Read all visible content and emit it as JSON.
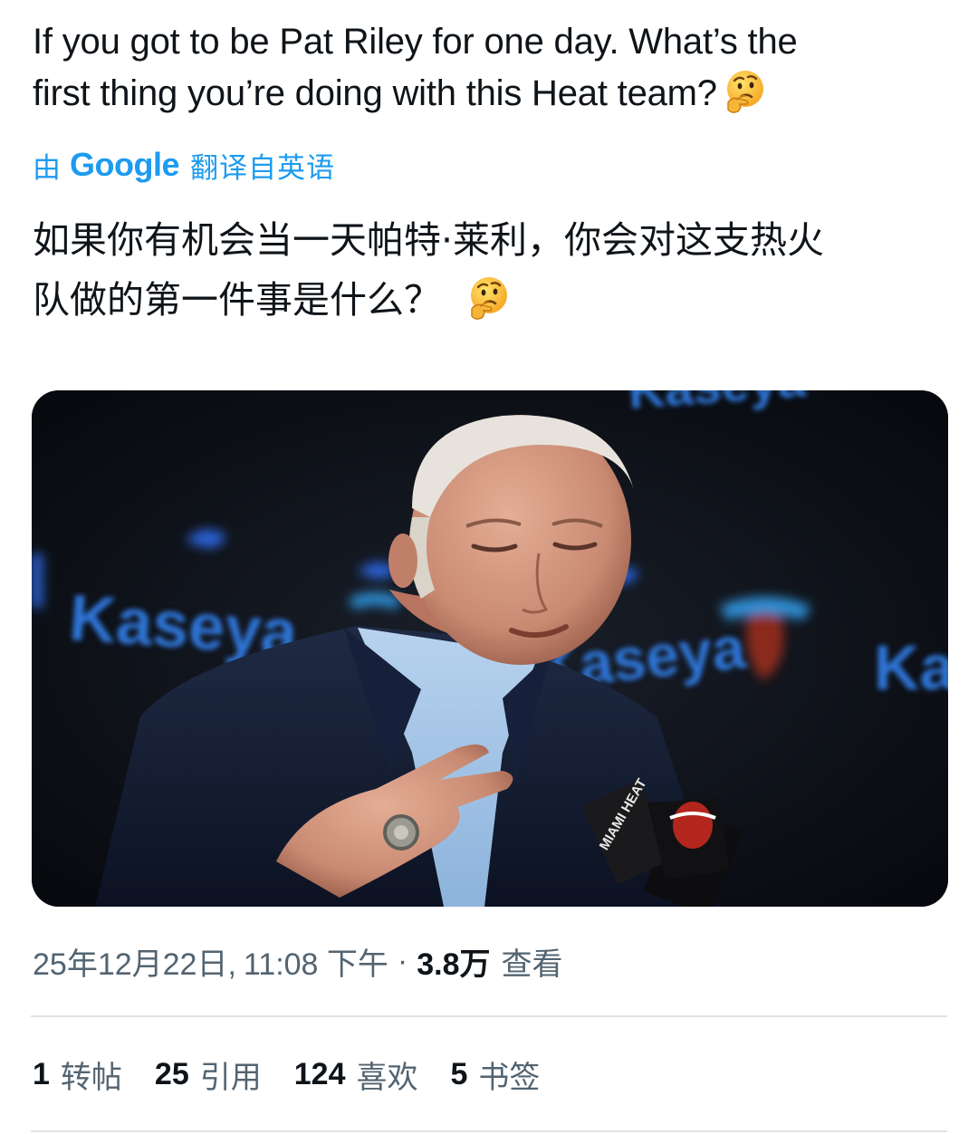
{
  "tweet": {
    "text_line1": "If you got to be Pat Riley for one day. What’s the",
    "text_line2": "first thing you’re doing with this Heat team?",
    "emoji_icon": "thinking-face-emoji"
  },
  "translation": {
    "by": "由",
    "provider": "Google",
    "from": "翻译自英语",
    "text_line1": "如果你有机会当一天帕特·莱利，你会对这支热火",
    "text_line2": "队做的第一件事是什么？"
  },
  "media": {
    "background_sign_text": "Kaseya",
    "mic_flag_text": "MIAMI HEAT"
  },
  "meta": {
    "date": "25年12月22日,",
    "time": "11:08 下午",
    "separator": "·",
    "views_count": "3.8万",
    "views_label": "查看"
  },
  "stats": [
    {
      "count": "1",
      "label": "转帖"
    },
    {
      "count": "25",
      "label": "引用"
    },
    {
      "count": "124",
      "label": "喜欢"
    },
    {
      "count": "5",
      "label": "书签"
    }
  ],
  "colors": {
    "accent": "#1d9bf0",
    "text_primary": "#0f1419",
    "text_secondary": "#536471",
    "divider": "#dfe3e6"
  }
}
